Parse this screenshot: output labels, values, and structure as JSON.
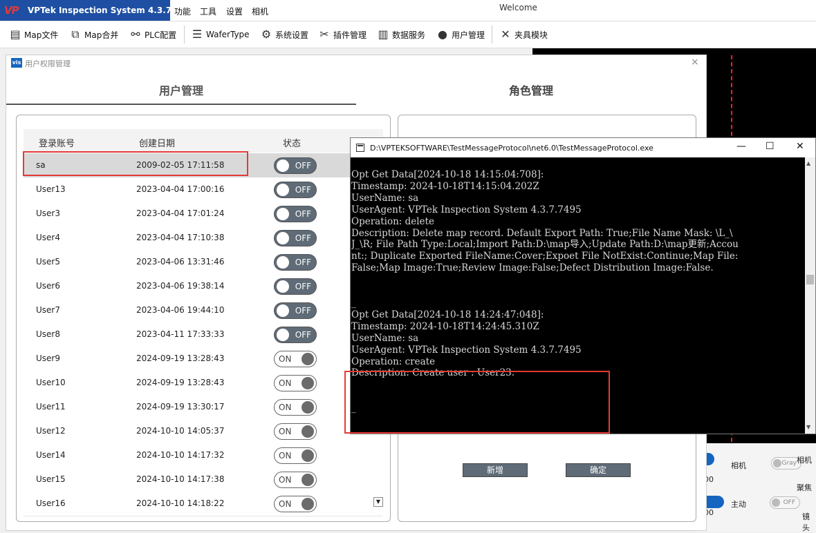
{
  "titlebar": {
    "logo": "VP",
    "app_title": "VPTek Inspection System 4.3.7.7495",
    "menus": [
      "功能",
      "工具",
      "设置",
      "相机"
    ],
    "welcome": "Welcome"
  },
  "toolbar": {
    "map_file": "Map文件",
    "map_merge": "Map合并",
    "plc_config": "PLC配置",
    "wafer_type": "WaferType",
    "system_settings": "系统设置",
    "plugin_mgmt": "插件管理",
    "data_service": "数据服务",
    "user_mgmt": "用户管理",
    "fixture_module": "夹具模块"
  },
  "background": {
    "camera_label": "相机",
    "camera_right": "相机",
    "focus_label": "聚焦",
    "active_label": "主动",
    "lens_label": "镜头",
    "gray_toggle": "Gray",
    "off_toggle": "OFF",
    "num1": "00",
    "num2": "00"
  },
  "dialog": {
    "icon_text": "vis",
    "title": "用户权限管理",
    "close": "×",
    "tab_user": "用户管理",
    "tab_role": "角色管理",
    "columns": {
      "account": "登录账号",
      "created": "创建日期",
      "status": "状态"
    },
    "users": [
      {
        "account": "sa",
        "created": "2009-02-05 17:11:58",
        "status": "OFF"
      },
      {
        "account": "User13",
        "created": "2023-04-04 17:00:16",
        "status": "OFF"
      },
      {
        "account": "User3",
        "created": "2023-04-04 17:01:24",
        "status": "OFF"
      },
      {
        "account": "User4",
        "created": "2023-04-04 17:10:38",
        "status": "OFF"
      },
      {
        "account": "User5",
        "created": "2023-04-06 13:31:46",
        "status": "OFF"
      },
      {
        "account": "User6",
        "created": "2023-04-06 19:38:14",
        "status": "OFF"
      },
      {
        "account": "User7",
        "created": "2023-04-06 19:44:10",
        "status": "OFF"
      },
      {
        "account": "User8",
        "created": "2023-04-11 17:33:33",
        "status": "OFF"
      },
      {
        "account": "User9",
        "created": "2024-09-19 13:28:43",
        "status": "ON"
      },
      {
        "account": "User10",
        "created": "2024-09-19 13:28:43",
        "status": "ON"
      },
      {
        "account": "User11",
        "created": "2024-09-19 13:30:17",
        "status": "ON"
      },
      {
        "account": "User12",
        "created": "2024-10-10 14:05:37",
        "status": "ON"
      },
      {
        "account": "User14",
        "created": "2024-10-10 14:17:32",
        "status": "ON"
      },
      {
        "account": "User15",
        "created": "2024-10-10 14:17:38",
        "status": "ON"
      },
      {
        "account": "User16",
        "created": "2024-10-10 14:18:22",
        "status": "ON"
      }
    ],
    "scroll_down": "▼",
    "role_add": "新增",
    "role_ok": "确定"
  },
  "console": {
    "title": "D:\\VPTEKSOFTWARE\\TestMessageProtocol\\net6.0\\TestMessageProtocol.exe",
    "minimize": "—",
    "maximize": "☐",
    "close": "✕",
    "lines": [
      "Opt Get Data[2024-10-18 14:15:04:708]:",
      "Timestamp: 2024-10-18T14:15:04.202Z",
      "UserName: sa",
      "UserAgent: VPTek Inspection System 4.3.7.7495",
      "Operation: delete",
      "Description: Delete map record. Default Export Path: True;File Name Mask: \\L_\\",
      "J_\\R; File Path Type:Local;Import Path:D:\\map导入;Update Path:D:\\map更新;Accou",
      "nt:; Duplicate Exported FileName:Cover;Expoet File NotExist:Continue;Map File:",
      "False;Map Image:True;Review Image:False;Defect Distribution Image:False.",
      "",
      "",
      "_",
      "Opt Get Data[2024-10-18 14:24:47:048]:",
      "Timestamp: 2024-10-18T14:24:45.310Z",
      "UserName: sa",
      "UserAgent: VPTek Inspection System 4.3.7.7495",
      "Operation: create",
      "Description: Create user : User23.",
      "",
      "",
      "_"
    ]
  }
}
